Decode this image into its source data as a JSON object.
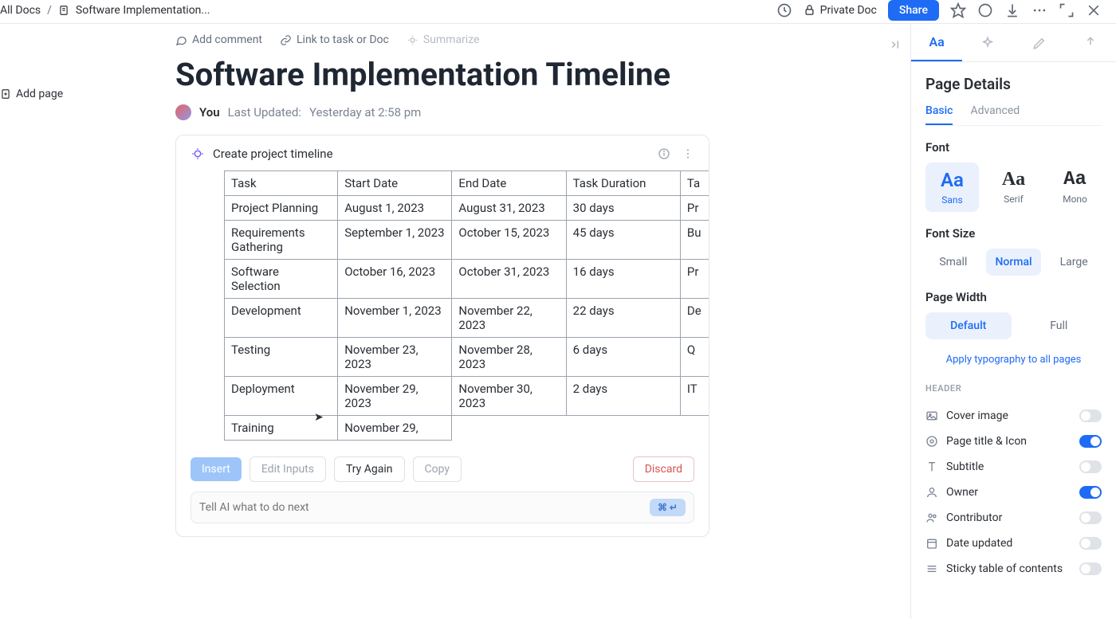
{
  "breadcrumb": {
    "root": "All Docs",
    "current": "Software Implementation..."
  },
  "topbar": {
    "private": "Private Doc",
    "share": "Share"
  },
  "leftRail": {
    "addPage": "Add page"
  },
  "docActions": {
    "comment": "Add comment",
    "link": "Link to task or Doc",
    "summarize": "Summarize"
  },
  "doc": {
    "title": "Software Implementation Timeline",
    "author": "You",
    "updated_label": "Last Updated:",
    "updated_value": "Yesterday at 2:58 pm"
  },
  "aiCard": {
    "title": "Create project timeline",
    "table": {
      "headers": [
        "Task",
        "Start Date",
        "End Date",
        "Task Duration",
        "Ta"
      ],
      "rows": [
        [
          "Project Planning",
          "August 1, 2023",
          "August 31, 2023",
          "30 days",
          "Pr"
        ],
        [
          "Requirements Gathering",
          "September 1, 2023",
          "October 15, 2023",
          "45 days",
          "Bu"
        ],
        [
          "Software Selection",
          "October 16, 2023",
          "October 31, 2023",
          "16 days",
          "Pr"
        ],
        [
          "Development",
          "November 1, 2023",
          "November 22, 2023",
          "22 days",
          "De"
        ],
        [
          "Testing",
          "November 23, 2023",
          "November 28, 2023",
          "6 days",
          "Q"
        ],
        [
          "Deployment",
          "November 29, 2023",
          "November 30, 2023",
          "2 days",
          "IT"
        ],
        [
          "Training",
          "November 29,",
          "",
          "",
          ""
        ]
      ]
    },
    "buttons": {
      "insert": "Insert",
      "edit": "Edit Inputs",
      "tryAgain": "Try Again",
      "copy": "Copy",
      "discard": "Discard"
    },
    "input": {
      "placeholder": "Tell AI what to do next",
      "shortcut": "⌘ ↵"
    }
  },
  "details": {
    "title": "Page Details",
    "subtabs": {
      "basic": "Basic",
      "advanced": "Advanced"
    },
    "font": {
      "label": "Font",
      "sans": "Sans",
      "serif": "Serif",
      "mono": "Mono"
    },
    "fontSize": {
      "label": "Font Size",
      "small": "Small",
      "normal": "Normal",
      "large": "Large"
    },
    "pageWidth": {
      "label": "Page Width",
      "default": "Default",
      "full": "Full"
    },
    "applyLink": "Apply typography to all pages",
    "headerLabel": "HEADER",
    "headerRows": {
      "cover": "Cover image",
      "titleIcon": "Page title & Icon",
      "subtitle": "Subtitle",
      "owner": "Owner",
      "contributor": "Contributor",
      "dateUpdated": "Date updated",
      "sticky": "Sticky table of contents"
    }
  }
}
